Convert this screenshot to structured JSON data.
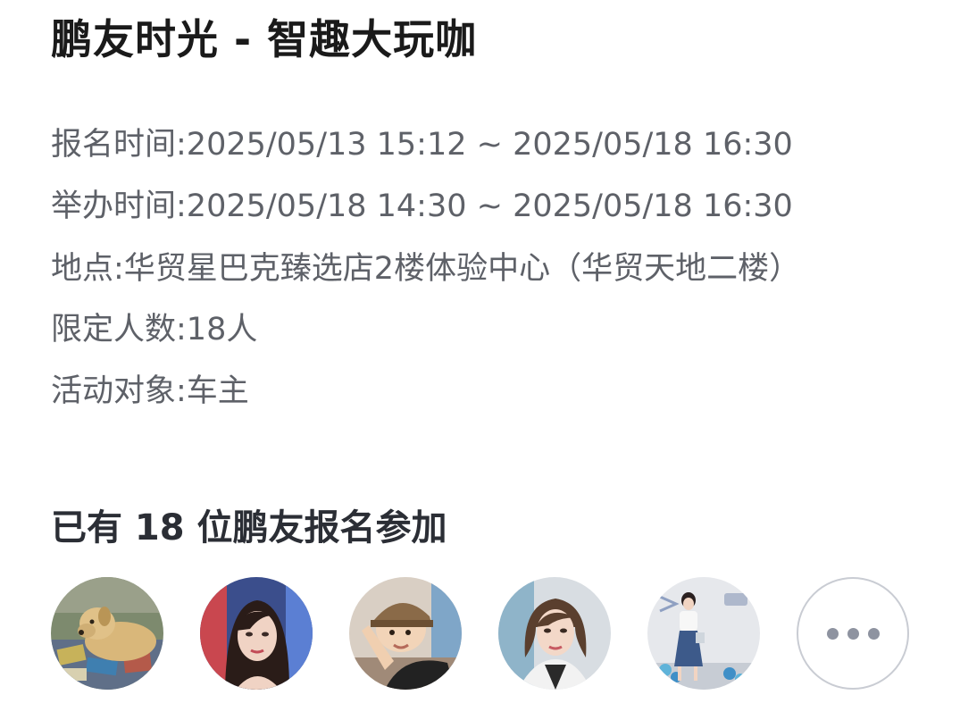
{
  "event": {
    "title": "鹏友时光 - 智趣大玩咖",
    "registration_time": {
      "label": "报名时间:",
      "value": "2025/05/13 15:12  ~  2025/05/18 16:30"
    },
    "event_time": {
      "label": "举办时间:",
      "value": "2025/05/18 14:30  ~  2025/05/18 16:30"
    },
    "location": {
      "label": "地点:",
      "value": "华贸星巴克臻选店2楼体验中心（华贸天地二楼）"
    },
    "capacity": {
      "label": "限定人数:",
      "value": "18人"
    },
    "audience": {
      "label": "活动对象:",
      "value": "车主"
    }
  },
  "participants": {
    "heading": "已有 18 位鹏友报名参加",
    "more_icon": "ellipsis-icon"
  }
}
